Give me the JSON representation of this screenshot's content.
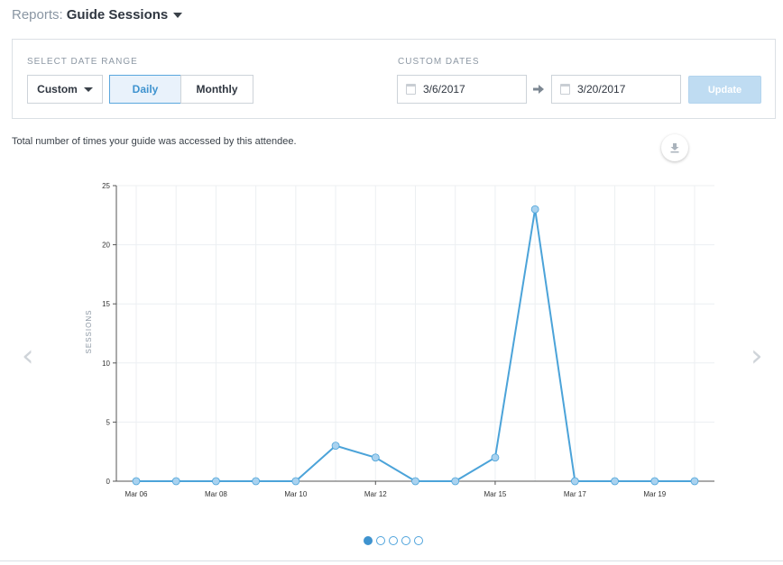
{
  "header": {
    "crumb": "Reports:",
    "title": "Guide Sessions"
  },
  "date_range": {
    "label": "SELECT DATE RANGE",
    "range_select": "Custom",
    "daily_label": "Daily",
    "monthly_label": "Monthly",
    "active": "Daily"
  },
  "custom_dates": {
    "label": "CUSTOM DATES",
    "start": "3/6/2017",
    "end": "3/20/2017",
    "update_label": "Update"
  },
  "description": "Total number of times your guide was accessed by this attendee.",
  "icons": {
    "dropdown": "chevron-down-icon",
    "calendar": "calendar-icon",
    "arrow": "arrow-right-icon",
    "download": "download-icon",
    "prev": "chevron-left-icon",
    "next": "chevron-right-icon"
  },
  "colors": {
    "line": "#4ba3d9",
    "accent": "#3f93cf",
    "update_bg": "#bfdcf2"
  },
  "chart_data": {
    "type": "line",
    "ylabel": "SESSIONS",
    "xlabel": "",
    "title": "",
    "ylim": [
      0,
      25
    ],
    "yticks": [
      0,
      5,
      10,
      15,
      20,
      25
    ],
    "x": [
      "Mar 06",
      "Mar 07",
      "Mar 08",
      "Mar 09",
      "Mar 10",
      "Mar 11",
      "Mar 12",
      "Mar 13",
      "Mar 14",
      "Mar 15",
      "Mar 16",
      "Mar 17",
      "Mar 18",
      "Mar 19",
      "Mar 20"
    ],
    "xtick_labels": [
      "Mar 06",
      "Mar 08",
      "Mar 10",
      "Mar 12",
      "Mar 15",
      "Mar 17",
      "Mar 19"
    ],
    "series": [
      {
        "values": [
          0,
          0,
          0,
          0,
          0,
          3,
          2,
          0,
          0,
          2,
          23,
          0,
          0,
          0,
          0
        ]
      }
    ],
    "grid": true
  },
  "pager": {
    "count": 5,
    "active": 0
  }
}
